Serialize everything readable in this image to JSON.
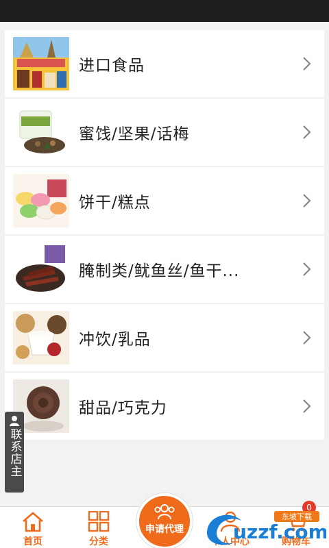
{
  "categories": [
    {
      "label": "进口食品",
      "image": "imported-food-image"
    },
    {
      "label": "蜜饯/坚果/话梅",
      "image": "nuts-jar-image"
    },
    {
      "label": "饼干/糕点",
      "image": "mochi-cakes-image"
    },
    {
      "label": "腌制类/鱿鱼丝/鱼干...",
      "image": "dried-fish-image"
    },
    {
      "label": "冲饮/乳品",
      "image": "yogurt-cereal-image"
    },
    {
      "label": "甜品/巧克力",
      "image": "chocolate-rose-image"
    }
  ],
  "contact_button": {
    "label": "联系店主",
    "icon": "person-icon"
  },
  "tabbar": {
    "home": {
      "label": "首页",
      "icon": "home-icon"
    },
    "category": {
      "label": "分类",
      "icon": "grid-icon"
    },
    "apply_agent": {
      "label": "申请代理",
      "icon": "group-icon"
    },
    "profile": {
      "label": "个人中心",
      "icon": "person-icon"
    },
    "cart": {
      "label": "购物车",
      "icon": "cart-icon",
      "badge": "0"
    }
  },
  "watermark": {
    "text": "uzzf.com",
    "tag": "东坡下载"
  },
  "colors": {
    "accent": "#f06a1c",
    "status_bar": "#1e1e1e",
    "background": "#f2f2f2"
  }
}
